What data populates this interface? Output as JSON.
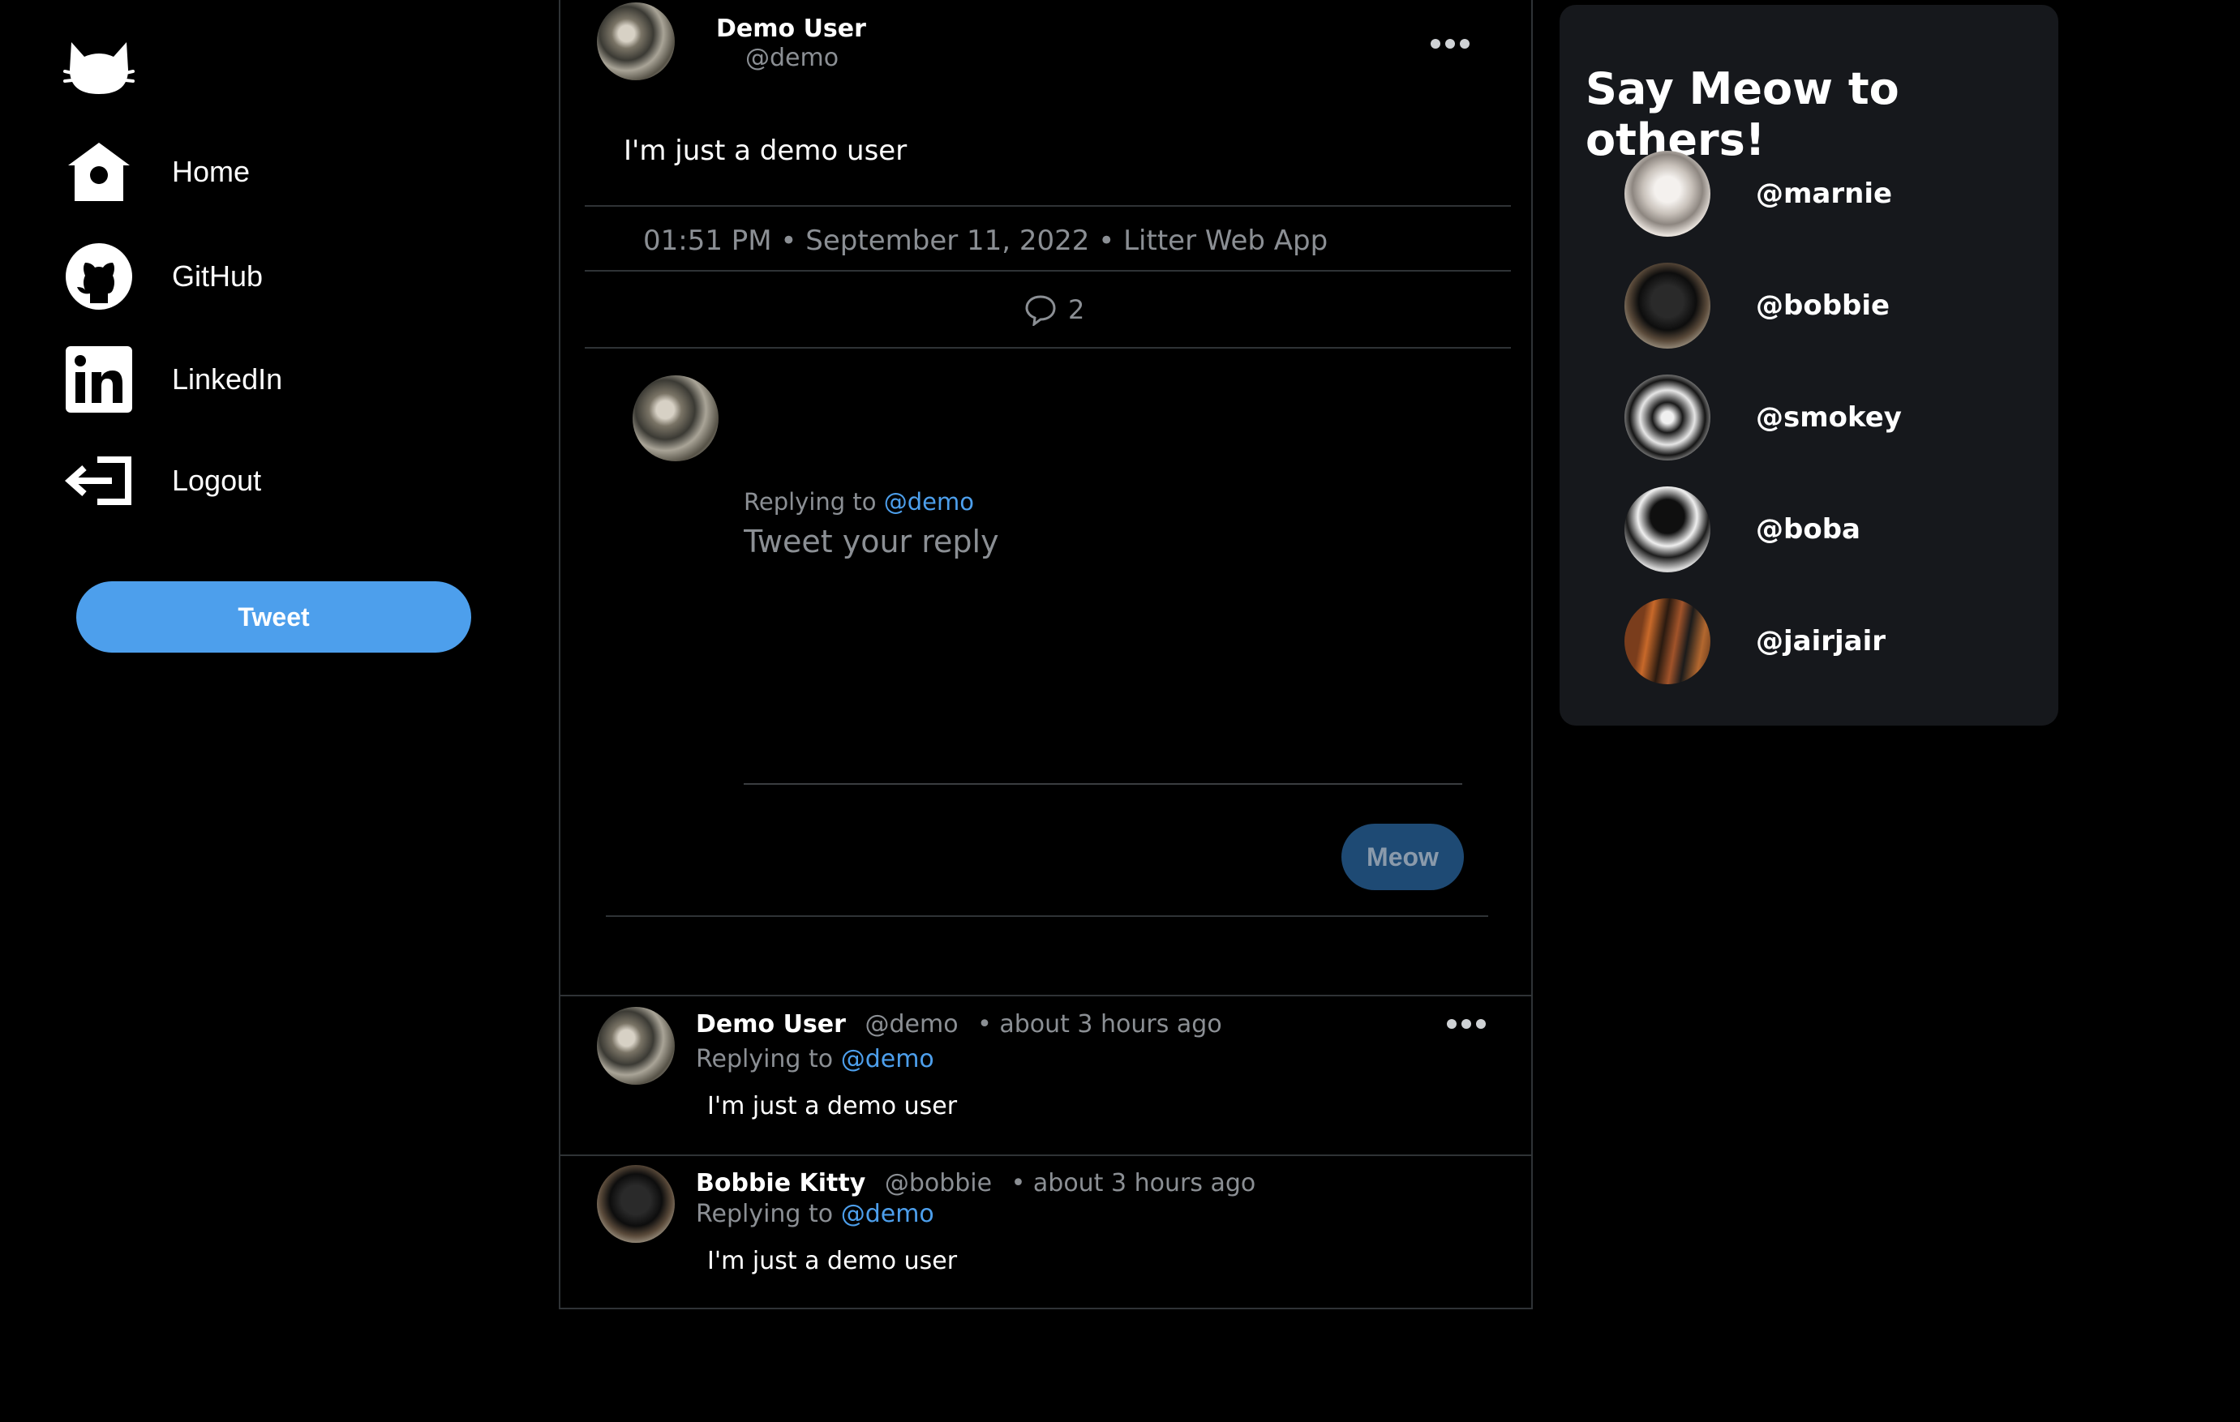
{
  "nav": {
    "logo_icon": "cat-head-icon",
    "items": [
      {
        "label": "Home",
        "icon": "birdhouse-icon"
      },
      {
        "label": "GitHub",
        "icon": "github-icon"
      },
      {
        "label": "LinkedIn",
        "icon": "linkedin-icon"
      },
      {
        "label": "Logout",
        "icon": "logout-arrow-icon"
      }
    ],
    "tweet_button": "Tweet"
  },
  "post": {
    "display_name": "Demo User",
    "handle": "@demo",
    "text": "I'm just a demo user",
    "meta": "01:51 PM • September 11, 2022 • Litter Web App",
    "reply_count": "2"
  },
  "composer": {
    "replying_prefix": "Replying to",
    "replying_handle": "@demo",
    "placeholder": "Tweet your reply",
    "submit_label": "Meow"
  },
  "replies": [
    {
      "display_name": "Demo User",
      "handle": "@demo",
      "time": "• about 3 hours ago",
      "replying_prefix": "Replying to",
      "replying_handle": "@demo",
      "text": "I'm just a demo user"
    },
    {
      "display_name": "Bobbie Kitty",
      "handle": "@bobbie",
      "time": "• about 3 hours ago",
      "replying_prefix": "Replying to",
      "replying_handle": "@demo",
      "text": "I'm just a demo user"
    }
  ],
  "suggestions": {
    "title": "Say Meow to others!",
    "users": [
      {
        "handle": "@marnie"
      },
      {
        "handle": "@bobbie"
      },
      {
        "handle": "@smokey"
      },
      {
        "handle": "@boba"
      },
      {
        "handle": "@jairjair"
      }
    ]
  },
  "colors": {
    "background": "#000000",
    "accent": "#4d9fec",
    "panel": "#16181c",
    "border": "#2f3336",
    "muted_text": "#8b8f94",
    "meow_button": "#1e4a74"
  }
}
